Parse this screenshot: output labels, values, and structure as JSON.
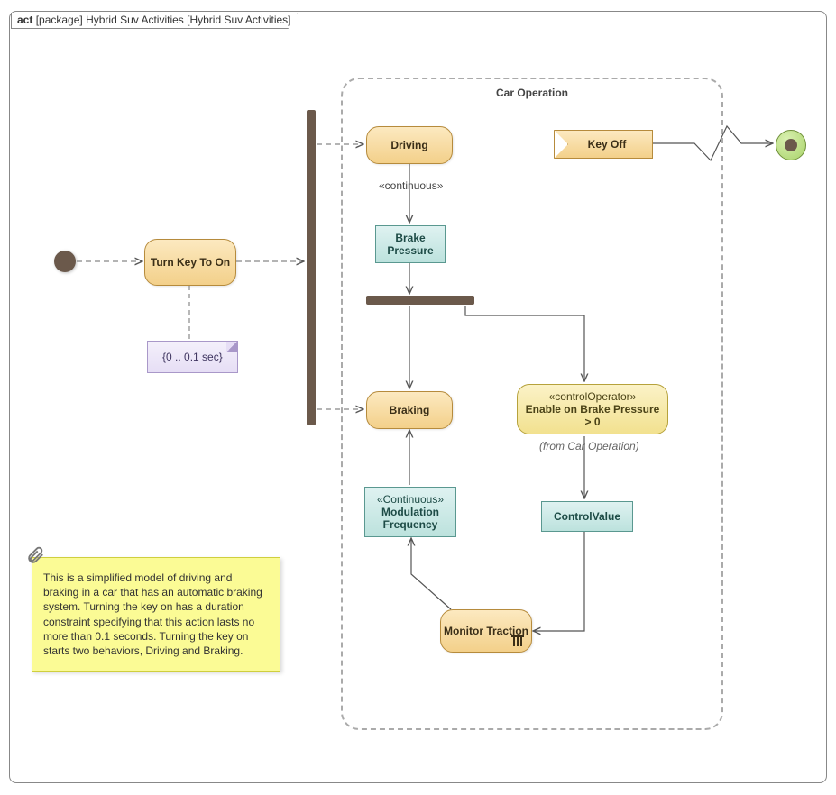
{
  "frame": {
    "kind": "act",
    "pkg": "[package]",
    "name": "Hybrid Suv Activities",
    "bracket": "[Hybrid Suv Activities]"
  },
  "region": {
    "title": "Car Operation"
  },
  "nodes": {
    "turnKey": "Turn Key To On",
    "driving": "Driving",
    "braking": "Braking",
    "brakePressure": "Brake Pressure",
    "modFreq": {
      "stereo": "«Continuous»",
      "label": "Modulation Frequency"
    },
    "ctrlOp": {
      "stereo": "«controlOperator»",
      "label": "Enable on Brake Pressure > 0"
    },
    "controlValue": "ControlValue",
    "monitor": "Monitor Traction",
    "acceptEvent": "Key Off"
  },
  "labels": {
    "continuous": "«continuous»",
    "fromCarOp": "(from Car Operation)"
  },
  "constraint": "{0 .. 0.1 sec}",
  "sticky": "This is a simplified model of driving and braking in a car that has an automatic braking system. Turning the key on has a duration constraint specifying that this action lasts no more than 0.1 seconds. Turning the key on starts two behaviors, Driving and Braking."
}
